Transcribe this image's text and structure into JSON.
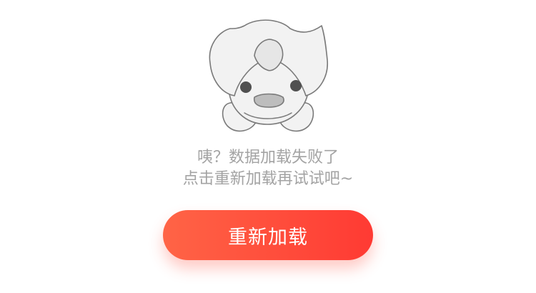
{
  "error": {
    "line1": "咦？数据加载失败了",
    "line2": "点击重新加载再试试吧~"
  },
  "reload_button": {
    "label": "重新加载"
  },
  "mascot": {
    "icon": "sad-mascot-icon"
  },
  "colors": {
    "background": "#ffffff",
    "message_text": "#a3a3a3",
    "button_gradient_start": "#ff6446",
    "button_gradient_end": "#ff3a33",
    "button_text": "#ffffff"
  }
}
